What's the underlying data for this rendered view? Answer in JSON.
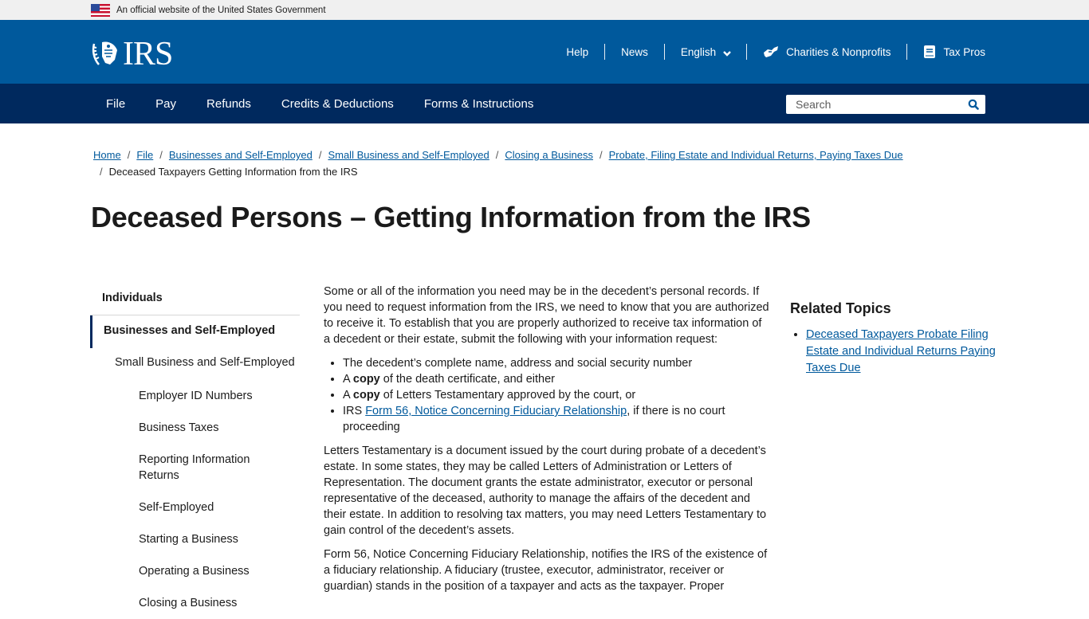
{
  "gov_banner": {
    "text": "An official website of the United States Government",
    "flag_icon": "us-flag-icon"
  },
  "header": {
    "logo_text": "IRS",
    "logo_icon": "irs-eagle-icon",
    "utility_nav": [
      {
        "label": "Help"
      },
      {
        "label": "News"
      },
      {
        "label": "English",
        "icon": "chevron-down-icon"
      },
      {
        "label": "Charities & Nonprofits",
        "icon": "handshake-icon"
      },
      {
        "label": "Tax Pros",
        "icon": "book-icon"
      }
    ]
  },
  "main_nav": {
    "items": [
      {
        "label": "File"
      },
      {
        "label": "Pay"
      },
      {
        "label": "Refunds"
      },
      {
        "label": "Credits & Deductions"
      },
      {
        "label": "Forms & Instructions"
      }
    ],
    "search": {
      "placeholder": "Search",
      "value": "",
      "icon": "search-icon"
    }
  },
  "breadcrumb": {
    "links": [
      "Home",
      "File",
      "Businesses and Self-Employed",
      "Small Business and Self-Employed",
      "Closing a Business",
      "Probate, Filing Estate and Individual Returns, Paying Taxes Due"
    ],
    "current": "Deceased Taxpayers Getting Information from the IRS",
    "separator": "/"
  },
  "page_title": "Deceased Persons – Getting Information from the IRS",
  "sidebar": {
    "items": [
      {
        "label": "Individuals",
        "level": 1
      },
      {
        "label": "Businesses and Self-Employed",
        "level": 1,
        "active": true
      },
      {
        "label": "Small Business and Self-Employed",
        "level": 2
      },
      {
        "label": "Employer ID Numbers",
        "level": 3
      },
      {
        "label": "Business Taxes",
        "level": 3
      },
      {
        "label": "Reporting Information Returns",
        "level": 3
      },
      {
        "label": "Self-Employed",
        "level": 3
      },
      {
        "label": "Starting a Business",
        "level": 3
      },
      {
        "label": "Operating a Business",
        "level": 3
      },
      {
        "label": "Closing a Business",
        "level": 3
      }
    ]
  },
  "content": {
    "intro": "Some or all of the information you need may be in the decedent’s personal records. If you need to request information from the IRS, we need to know that you are authorized to receive it. To establish that you are properly authorized to receive tax information of a decedent or their estate, submit the following with your information request:",
    "list": {
      "item1": "The decedent’s complete name, address and social security number",
      "item2_prefix": "A ",
      "item2_bold": "copy",
      "item2_suffix": " of the death certificate, and either",
      "item3_prefix": "A ",
      "item3_bold": "copy",
      "item3_suffix": " of Letters Testamentary approved by the court, or",
      "item4_prefix": "IRS ",
      "item4_link": "Form 56, Notice Concerning Fiduciary Relationship",
      "item4_suffix": ", if there is no court proceeding"
    },
    "para2": "Letters Testamentary is a document issued by the court during probate of a decedent’s estate. In some states, they may be called Letters of Administration or Letters of Representation. The document grants the estate administrator, executor or personal representative of the deceased, authority to manage the affairs of the decedent and their estate. In addition to resolving tax matters, you may need Letters Testamentary to gain control of the decedent’s assets.",
    "para3": "Form 56, Notice Concerning Fiduciary Relationship, notifies the IRS of the existence of a fiduciary relationship. A fiduciary (trustee, executor, administrator, receiver or guardian) stands in the position of a taxpayer and acts as the taxpayer. Proper"
  },
  "related": {
    "heading": "Related Topics",
    "links": [
      "Deceased Taxpayers Probate Filing Estate and Individual Returns Paying Taxes Due"
    ]
  },
  "colors": {
    "header_blue": "#00599c",
    "nav_navy": "#00295e",
    "link": "#00599c",
    "banner_bg": "#f0f0f0"
  }
}
